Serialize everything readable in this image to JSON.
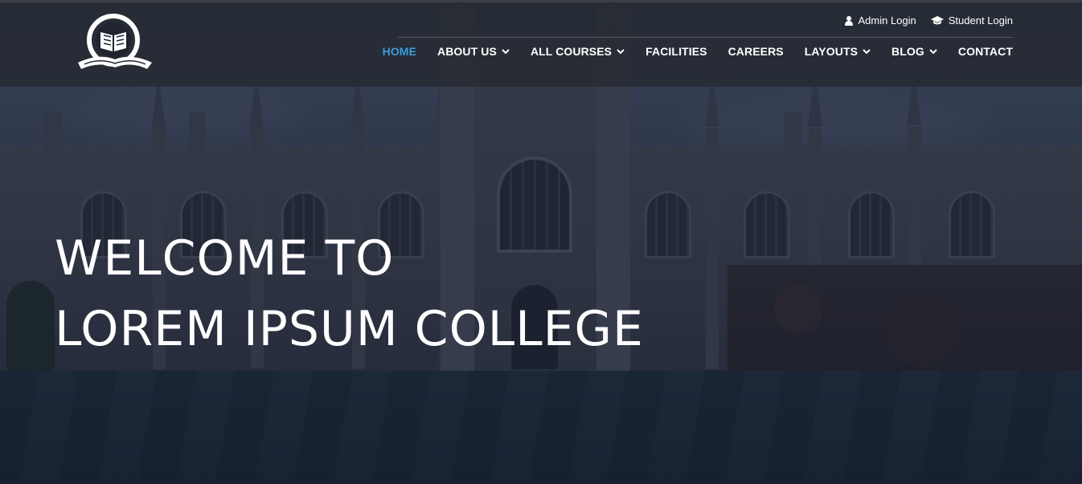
{
  "header": {
    "top_links": [
      {
        "label": "Admin Login",
        "icon": "user-icon"
      },
      {
        "label": "Student Login",
        "icon": "graduation-cap-icon"
      }
    ],
    "nav": [
      {
        "label": "HOME",
        "active": true,
        "dropdown": false
      },
      {
        "label": "ABOUT US",
        "active": false,
        "dropdown": true
      },
      {
        "label": "ALL COURSES",
        "active": false,
        "dropdown": true
      },
      {
        "label": "FACILITIES",
        "active": false,
        "dropdown": false
      },
      {
        "label": "CAREERS",
        "active": false,
        "dropdown": false
      },
      {
        "label": "LAYOUTS",
        "active": false,
        "dropdown": true
      },
      {
        "label": "BLOG",
        "active": false,
        "dropdown": true
      },
      {
        "label": "CONTACT",
        "active": false,
        "dropdown": false
      }
    ]
  },
  "hero": {
    "line1": "WELCOME TO",
    "line2": "LOREM IPSUM COLLEGE"
  },
  "colors": {
    "active_nav": "#3c9bde",
    "header_bg": "#262a32",
    "text": "#ffffff"
  }
}
